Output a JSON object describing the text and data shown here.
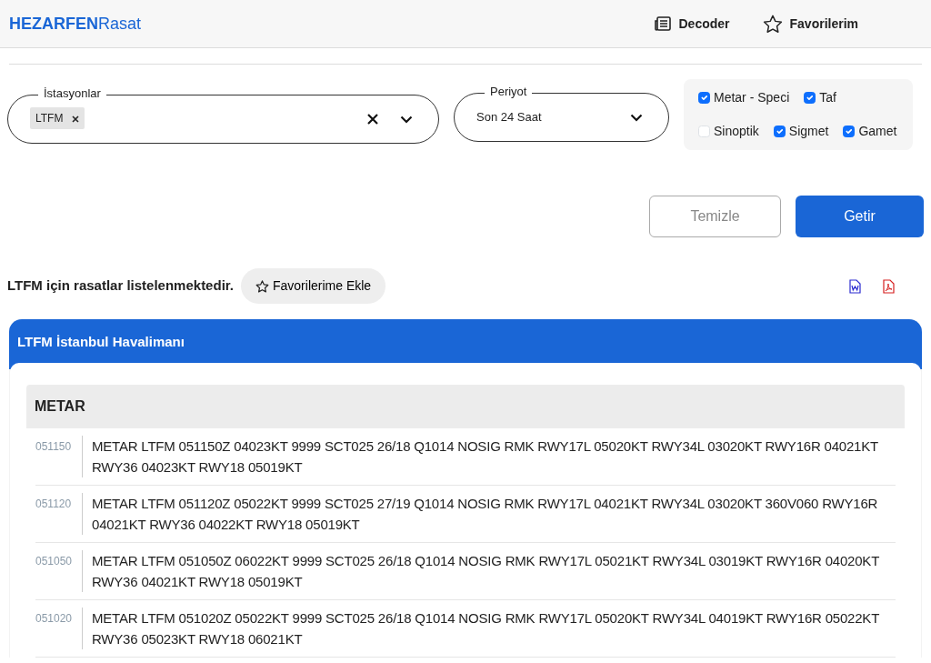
{
  "brand": {
    "bold": "HEZARFEN",
    "light": "Rasat"
  },
  "nav": [
    {
      "kind": "decoder",
      "label": "Decoder"
    },
    {
      "kind": "star",
      "label": "Favorilerim"
    }
  ],
  "stations": {
    "label": "İstasyonlar",
    "tags": [
      "LTFM"
    ]
  },
  "period": {
    "label": "Periyot",
    "value": "Son 24 Saat"
  },
  "types": [
    {
      "label": "Metar - Speci",
      "checked": true
    },
    {
      "label": "Taf",
      "checked": true
    },
    {
      "label": "Sinoptik",
      "checked": false
    },
    {
      "label": "Sigmet",
      "checked": true
    },
    {
      "label": "Gamet",
      "checked": true
    }
  ],
  "buttons": {
    "clear": "Temizle",
    "fetch": "Getir"
  },
  "info": {
    "text": "LTFM için rasatlar listelenmektedir.",
    "favorite_button": "Favorilerime Ekle"
  },
  "station_card": {
    "title": "LTFM İstanbul Havalimanı",
    "section": "METAR",
    "rows": [
      {
        "time": "051150",
        "report": "METAR LTFM 051150Z 04023KT 9999 SCT025 26/18 Q1014 NOSIG RMK RWY17L 05020KT RWY34L 03020KT RWY16R 04021KT RWY36 04023KT RWY18 05019KT"
      },
      {
        "time": "051120",
        "report": "METAR LTFM 051120Z 05022KT 9999 SCT025 27/19 Q1014 NOSIG RMK RWY17L 04021KT RWY34L 03020KT 360V060 RWY16R 04021KT RWY36 04022KT RWY18 05019KT"
      },
      {
        "time": "051050",
        "report": "METAR LTFM 051050Z 06022KT 9999 SCT025 26/18 Q1014 NOSIG RMK RWY17L 05021KT RWY34L 03019KT RWY16R 04020KT RWY36 04021KT RWY18 05019KT"
      },
      {
        "time": "051020",
        "report": "METAR LTFM 051020Z 05022KT 9999 SCT025 26/18 Q1014 NOSIG RMK RWY17L 05020KT RWY34L 04019KT RWY16R 05022KT RWY36 05023KT RWY18 06021KT"
      }
    ]
  }
}
